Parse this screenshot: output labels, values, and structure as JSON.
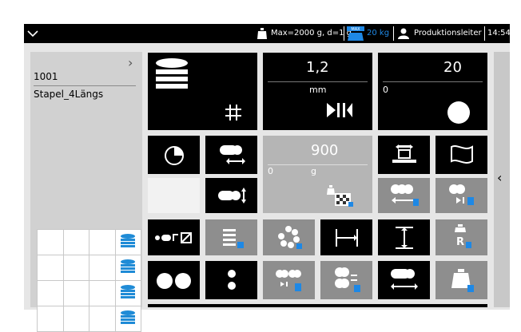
{
  "status_bar": {
    "scale_text": "Max=2000 g, d=1 g",
    "max_label": "MAX",
    "weight_capacity": "20 kg",
    "user": "Produktionsleiter",
    "time": "14:54"
  },
  "product": {
    "number": "1001",
    "name": "Stapel_4Längs"
  },
  "params": {
    "thickness_value": "1,2",
    "thickness_unit": "mm",
    "count_value": "20",
    "count_min": "0",
    "weight_value": "900",
    "weight_min": "0",
    "weight_unit": "g"
  },
  "colors": {
    "tile_black": "#000000",
    "tile_gray": "#8e8e8e",
    "accent_blue": "#1e88e5",
    "stack_blue": "#1f8bd6"
  },
  "icons": [
    "chevron-down-icon",
    "scale-icon",
    "user-icon",
    "stack-icon",
    "grid-icon",
    "pie-chart-icon",
    "flag-icon",
    "lock-icon",
    "chevron-left-icon",
    "chevron-right-icon"
  ]
}
